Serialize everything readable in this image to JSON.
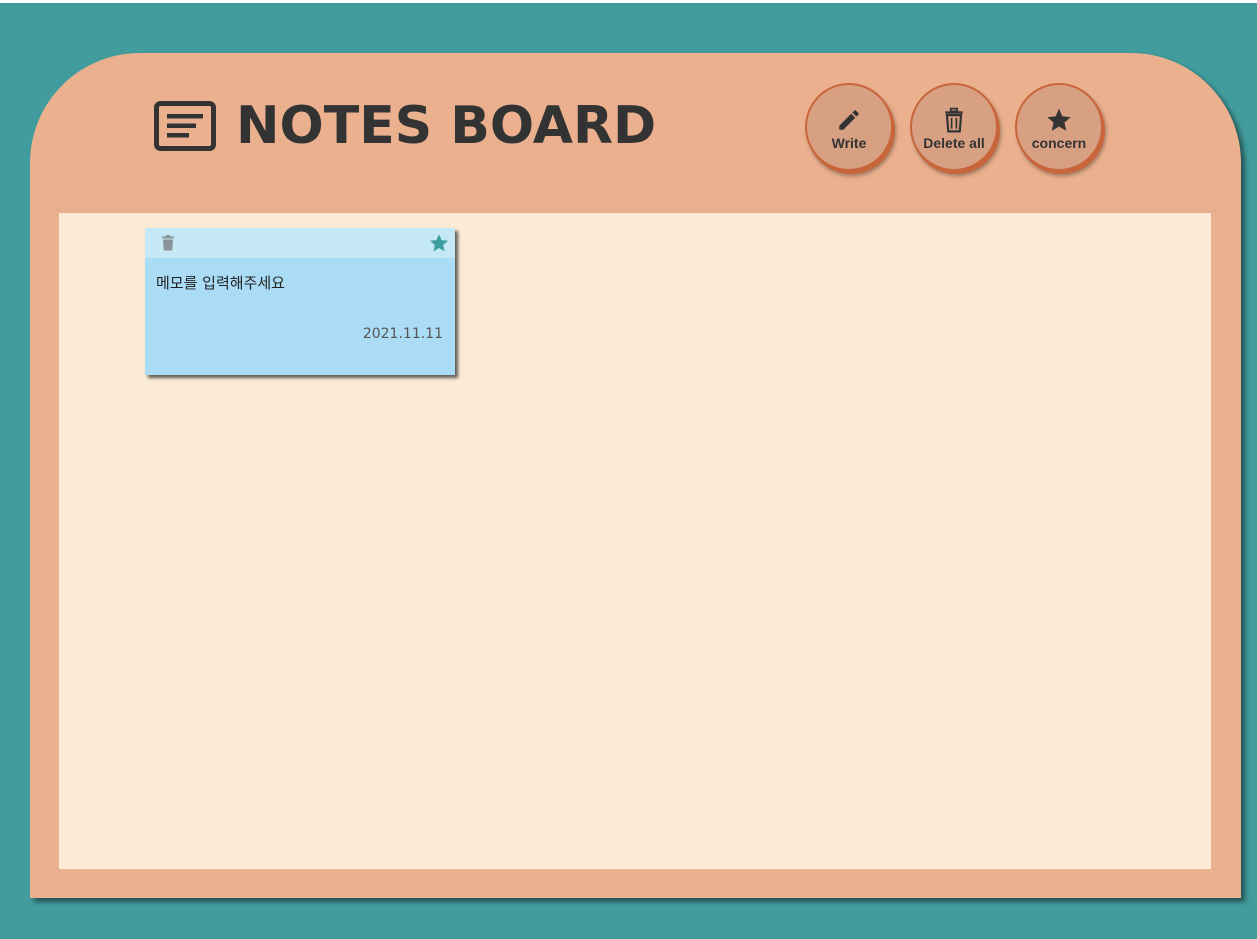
{
  "header": {
    "title": "NOTES BOARD",
    "title_icon": "notes-icon"
  },
  "toolbar": {
    "write": {
      "label": "Write",
      "icon": "pencil-icon"
    },
    "delete_all": {
      "label": "Delete all",
      "icon": "trash-icon"
    },
    "concern": {
      "label": "concern",
      "icon": "star-icon"
    }
  },
  "notes": [
    {
      "text": "메모를 입력해주세요",
      "date": "2021.11.11",
      "starred": true,
      "delete_icon": "trash-icon",
      "star_icon": "star-icon"
    }
  ],
  "colors": {
    "background": "#429b9c",
    "board": "#ebb18f",
    "content": "#faead6",
    "note": "#aadcf6",
    "note_bar": "#c5e8f7",
    "star_active": "#3c9ea0",
    "button": "#d8a083",
    "button_border": "#c9653b"
  }
}
